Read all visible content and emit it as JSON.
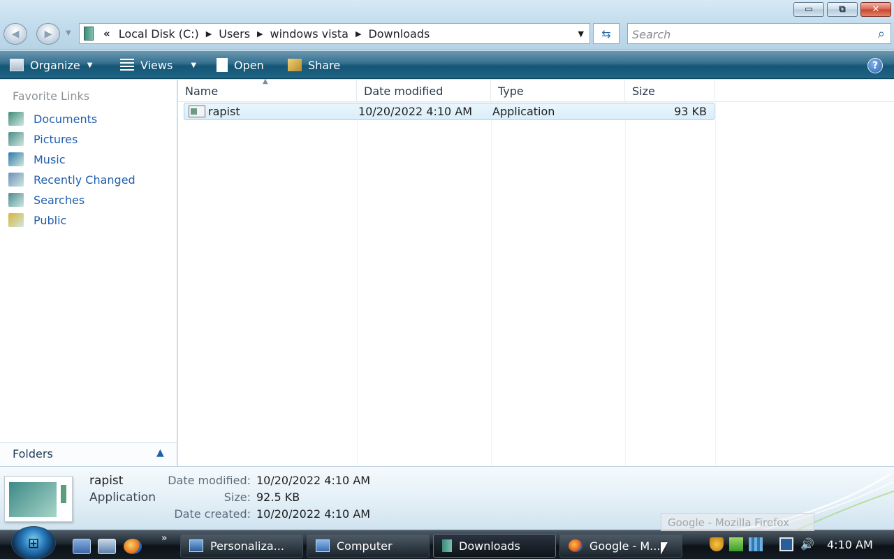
{
  "window": {
    "caption_buttons": {
      "minimize": "▭",
      "maximize": "⧉",
      "close": "✕"
    },
    "address": {
      "overflow": "«",
      "crumbs": [
        "Local Disk (C:)",
        "Users",
        "windows vista",
        "Downloads"
      ]
    },
    "search": {
      "placeholder": "Search",
      "value": ""
    }
  },
  "commandbar": {
    "organize": "Organize",
    "views": "Views",
    "open": "Open",
    "share": "Share",
    "help": "?"
  },
  "navpane": {
    "title": "Favorite Links",
    "links": [
      {
        "label": "Documents",
        "icon": "documents-icon",
        "color": "#3f8a7a"
      },
      {
        "label": "Pictures",
        "icon": "pictures-icon",
        "color": "#4a8c86"
      },
      {
        "label": "Music",
        "icon": "music-icon",
        "color": "#2f79a8"
      },
      {
        "label": "Recently Changed",
        "icon": "recently-changed-icon",
        "color": "#6a8fb8"
      },
      {
        "label": "Searches",
        "icon": "searches-icon",
        "color": "#4c8a90"
      },
      {
        "label": "Public",
        "icon": "public-folder-icon",
        "color": "#d9b43a"
      }
    ],
    "folders_label": "Folders"
  },
  "filelist": {
    "columns": {
      "name": "Name",
      "date": "Date modified",
      "type": "Type",
      "size": "Size"
    },
    "rows": [
      {
        "name": "rapist",
        "date": "10/20/2022 4:10 AM",
        "type": "Application",
        "size": "93 KB"
      }
    ]
  },
  "details": {
    "name": "rapist",
    "type": "Application",
    "date_modified_label": "Date modified:",
    "date_modified": "10/20/2022 4:10 AM",
    "size_label": "Size:",
    "size": "92.5 KB",
    "date_created_label": "Date created:",
    "date_created": "10/20/2022 4:10 AM"
  },
  "taskbar": {
    "quicklaunch_more": "»",
    "buttons": [
      {
        "label": "Personaliza...",
        "icon": "personalization-icon"
      },
      {
        "label": "Computer",
        "icon": "computer-icon"
      },
      {
        "label": "Downloads",
        "icon": "folder-icon"
      },
      {
        "label": "Google - M...",
        "icon": "firefox-icon"
      }
    ],
    "clock": "4:10 AM"
  },
  "tooltip": "Google - Mozilla Firefox",
  "colors": {
    "link": "#1f5fae",
    "commandbar": "#155576",
    "selection": "#d9eefa"
  }
}
